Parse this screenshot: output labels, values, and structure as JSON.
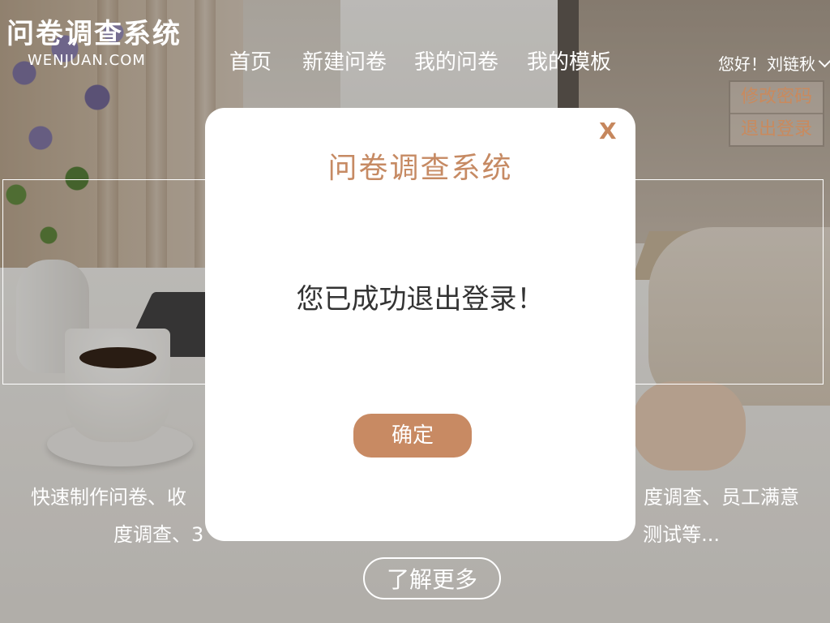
{
  "header": {
    "logo_title": "问卷调查系统",
    "logo_subtitle": "WENJUAN.COM",
    "nav": [
      {
        "label": "首页"
      },
      {
        "label": "新建问卷"
      },
      {
        "label": "我的问卷"
      },
      {
        "label": "我的模板"
      }
    ],
    "user_greeting": "您好！刘链秋",
    "user_menu": {
      "change_password": "修改密码",
      "logout": "退出登录"
    }
  },
  "banner": {
    "line1": "快速制作问卷、收",
    "line1_right": "度调查、员工满意",
    "line2": "度调查、3",
    "line2_right": "测试等...",
    "more_button": "了解更多"
  },
  "modal": {
    "close_label": "X",
    "title": "问卷调查系统",
    "message": "您已成功退出登录！",
    "confirm_button": "确定"
  },
  "colors": {
    "accent": "#c88a63",
    "modal_bg": "#ffffff",
    "text_dark": "#333333"
  }
}
